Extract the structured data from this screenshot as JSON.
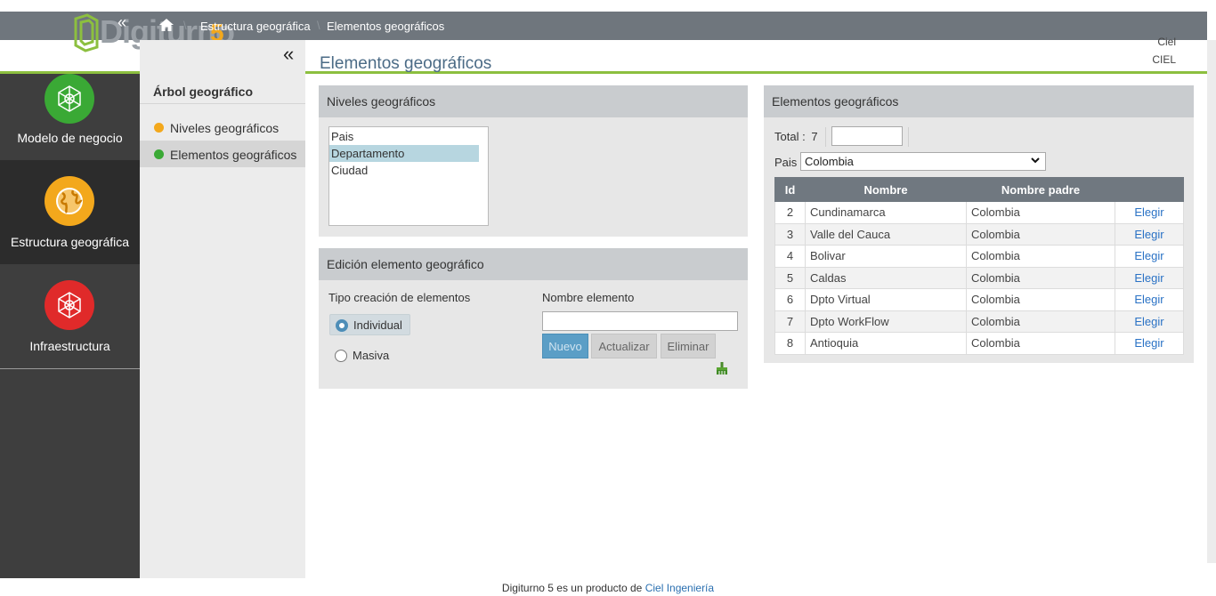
{
  "header": {
    "logo_text": "Digiturno",
    "logo_number": "5",
    "logo_sub": "plus",
    "breadcrumb": [
      "Estructura geográfica",
      "Elementos geográficos"
    ],
    "breadcrumb_sep": "\\",
    "user_name": "Ciel",
    "user_code": "CIEL",
    "collapse_glyph": "«"
  },
  "sidebar": {
    "items": [
      {
        "label": "Modelo de negocio",
        "icon": "network-icon",
        "color": "#3aa935"
      },
      {
        "label": "Estructura geográfica",
        "icon": "globe-icon",
        "color": "#f3a81c",
        "active": true
      },
      {
        "label": "Infraestructura",
        "icon": "network-icon",
        "color": "#e02a2a"
      }
    ]
  },
  "tree": {
    "title": "Árbol geográfico",
    "collapse_glyph": "«",
    "items": [
      {
        "label": "Niveles geográficos",
        "color": "#f3a81c"
      },
      {
        "label": "Elementos geográficos",
        "color": "#3aa935",
        "active": true
      }
    ]
  },
  "page_title": "Elementos geográficos",
  "niveles": {
    "title": "Niveles geográficos",
    "options": [
      "Pais",
      "Departamento",
      "Ciudad"
    ],
    "selected": "Departamento"
  },
  "edicion": {
    "title": "Edición elemento geográfico",
    "tipo_label": "Tipo creación de elementos",
    "radio_individual": "Individual",
    "radio_masiva": "Masiva",
    "selected_radio": "Individual",
    "nombre_label": "Nombre elemento",
    "nombre_value": "",
    "btn_nuevo": "Nuevo",
    "btn_actualizar": "Actualizar",
    "btn_eliminar": "Eliminar"
  },
  "elementos": {
    "title": "Elementos geográficos",
    "total_label": "Total :",
    "total_value": "7",
    "filter_value": "",
    "pais_label": "Pais",
    "pais_selected": "Colombia",
    "columns": [
      "Id",
      "Nombre",
      "Nombre padre",
      ""
    ],
    "action_label": "Elegir",
    "rows": [
      {
        "id": "2",
        "nombre": "Cundinamarca",
        "padre": "Colombia"
      },
      {
        "id": "3",
        "nombre": "Valle del Cauca",
        "padre": "Colombia"
      },
      {
        "id": "4",
        "nombre": "Bolivar",
        "padre": "Colombia"
      },
      {
        "id": "5",
        "nombre": "Caldas",
        "padre": "Colombia"
      },
      {
        "id": "6",
        "nombre": "Dpto Virtual",
        "padre": "Colombia"
      },
      {
        "id": "7",
        "nombre": "Dpto WorkFlow",
        "padre": "Colombia"
      },
      {
        "id": "8",
        "nombre": "Antioquia",
        "padre": "Colombia"
      }
    ]
  },
  "footer": {
    "text": "Digiturno 5 es un producto de",
    "link": "Ciel Ingeniería"
  }
}
